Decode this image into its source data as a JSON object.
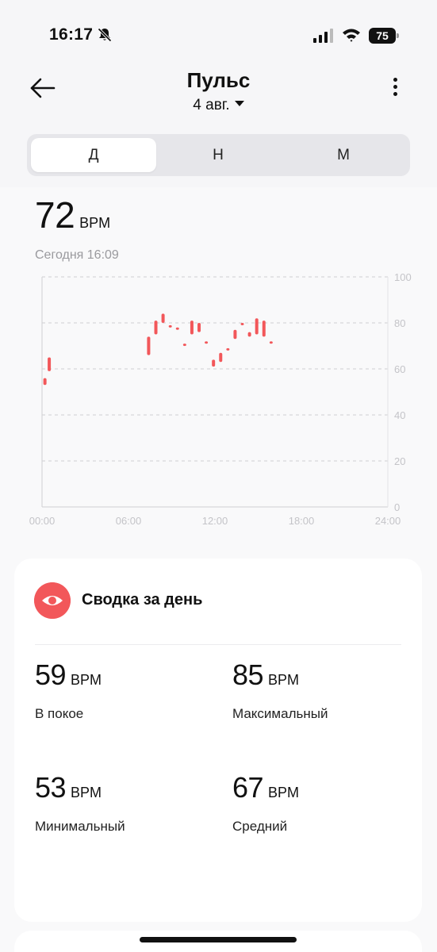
{
  "status_bar": {
    "time": "16:17",
    "battery": "75"
  },
  "header": {
    "title": "Пульс",
    "date": "4 авг."
  },
  "tabs": [
    {
      "label": "Д",
      "active": true
    },
    {
      "label": "Н",
      "active": false
    },
    {
      "label": "М",
      "active": false
    }
  ],
  "current": {
    "value": "72",
    "unit": "BPM",
    "timestamp": "Сегодня 16:09"
  },
  "chart_data": {
    "type": "range-bar",
    "x_ticks": [
      "00:00",
      "06:00",
      "12:00",
      "18:00",
      "24:00"
    ],
    "y_ticks": [
      "0",
      "20",
      "40",
      "60",
      "80",
      "100"
    ],
    "ylim": [
      0,
      100
    ],
    "xlim_hours": [
      0,
      24
    ],
    "color": "#f2575a",
    "grid": true,
    "points": [
      {
        "t": 0.2,
        "min": 53,
        "max": 56
      },
      {
        "t": 0.5,
        "min": 59,
        "max": 65
      },
      {
        "t": 7.4,
        "min": 66,
        "max": 74
      },
      {
        "t": 7.9,
        "min": 75,
        "max": 81
      },
      {
        "t": 8.4,
        "min": 80,
        "max": 84
      },
      {
        "t": 8.9,
        "min": 78,
        "max": 79
      },
      {
        "t": 9.4,
        "min": 77,
        "max": 78
      },
      {
        "t": 9.9,
        "min": 70,
        "max": 71
      },
      {
        "t": 10.4,
        "min": 75,
        "max": 81
      },
      {
        "t": 10.9,
        "min": 76,
        "max": 80
      },
      {
        "t": 11.4,
        "min": 71,
        "max": 72
      },
      {
        "t": 11.9,
        "min": 61,
        "max": 64
      },
      {
        "t": 12.4,
        "min": 63,
        "max": 67
      },
      {
        "t": 12.9,
        "min": 68,
        "max": 69
      },
      {
        "t": 13.4,
        "min": 73,
        "max": 77
      },
      {
        "t": 13.9,
        "min": 79,
        "max": 80
      },
      {
        "t": 14.4,
        "min": 74,
        "max": 76
      },
      {
        "t": 14.9,
        "min": 75,
        "max": 82
      },
      {
        "t": 15.4,
        "min": 74,
        "max": 81
      },
      {
        "t": 15.9,
        "min": 71,
        "max": 72
      }
    ]
  },
  "summary": {
    "title": "Сводка за день",
    "stats": [
      {
        "value": "59",
        "unit": "BPM",
        "label": "В покое"
      },
      {
        "value": "85",
        "unit": "BPM",
        "label": "Максимальный"
      },
      {
        "value": "53",
        "unit": "BPM",
        "label": "Минимальный"
      },
      {
        "value": "67",
        "unit": "BPM",
        "label": "Средний"
      }
    ]
  }
}
